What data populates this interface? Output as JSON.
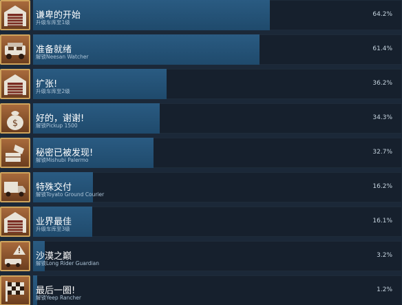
{
  "achievements": [
    {
      "title": "谦卑的开始",
      "subtitle": "升级车库至1级",
      "percent_label": "64.2%",
      "percent": 64.2,
      "icon": "garage-icon"
    },
    {
      "title": "准备就绪",
      "subtitle": "解锁Neesan Watcher",
      "percent_label": "61.4%",
      "percent": 61.4,
      "icon": "truck-icon"
    },
    {
      "title": "扩张!",
      "subtitle": "升级车库至2级",
      "percent_label": "36.2%",
      "percent": 36.2,
      "icon": "garage-icon"
    },
    {
      "title": "好的，谢谢!",
      "subtitle": "解锁Pickup 1500",
      "percent_label": "34.3%",
      "percent": 34.3,
      "icon": "money-bag-icon"
    },
    {
      "title": "秘密已被发现!",
      "subtitle": "解锁Mishubi Palermo",
      "percent_label": "32.7%",
      "percent": 32.7,
      "icon": "hand-box-icon"
    },
    {
      "title": "特殊交付",
      "subtitle": "解锁Toyato Ground Courier",
      "percent_label": "16.2%",
      "percent": 16.2,
      "icon": "delivery-truck-icon"
    },
    {
      "title": "业界最佳",
      "subtitle": "升级车库至3级",
      "percent_label": "16.1%",
      "percent": 16.1,
      "icon": "garage-icon"
    },
    {
      "title": "沙漠之巅",
      "subtitle": "解锁Long Rider Guardian",
      "percent_label": "3.2%",
      "percent": 3.2,
      "icon": "warning-car-icon"
    },
    {
      "title": "最后一圈!",
      "subtitle": "解锁Yeep Rancher",
      "percent_label": "1.2%",
      "percent": 1.2,
      "icon": "checkered-flag-icon"
    }
  ]
}
